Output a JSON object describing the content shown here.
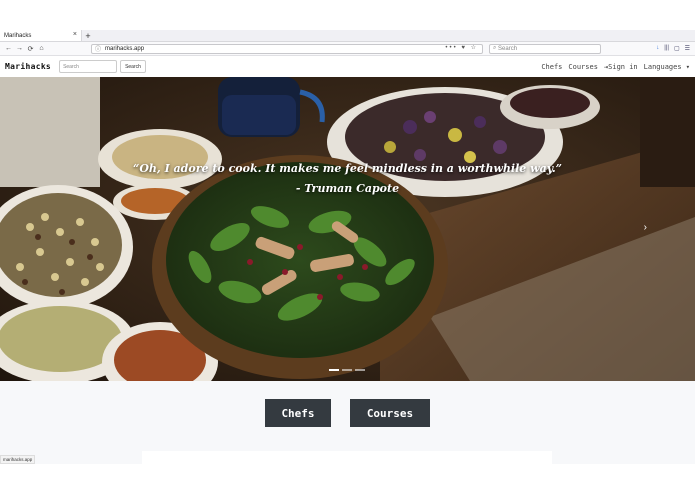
{
  "browser": {
    "tab_title": "Marihacks",
    "tab_close": "×",
    "new_tab": "+",
    "url": "marihacks.app",
    "url_actions": "••• ♥ ☆",
    "search_placeholder": "Search",
    "nav": {
      "back": "←",
      "forward": "→",
      "reload": "⟳",
      "home": "⌂",
      "page": "ⓘ"
    },
    "toolbar": [
      "↓",
      "|||",
      "▢",
      "☰"
    ],
    "status_text": "marihacks.app"
  },
  "site": {
    "logo": "Marihacks",
    "search_placeholder": "Search",
    "search_button": "Search",
    "nav": {
      "chefs": "Chefs",
      "courses": "Courses",
      "signin": "⇥Sign in",
      "languages": "Languages ▾"
    },
    "hero": {
      "quote": "“Oh, I adore to cook. It makes me feel mindless in a worthwhile way.”",
      "author": "- Truman Capote",
      "next": "›"
    },
    "buttons": {
      "chefs": "Chefs",
      "courses": "Courses"
    }
  }
}
